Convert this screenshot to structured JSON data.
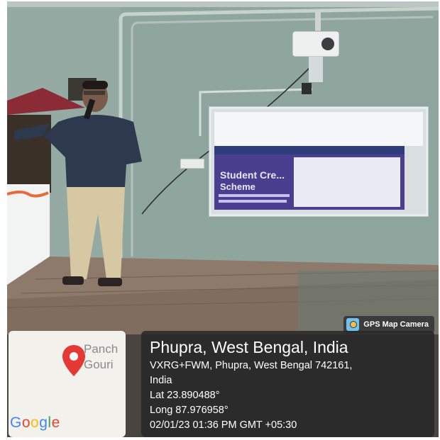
{
  "image": {
    "scene": "presentation-in-classroom",
    "description_elements": [
      "presenter-with-microphone",
      "projector",
      "projection-screen",
      "stage",
      "wall-conduit"
    ]
  },
  "projection": {
    "slide_heading": "Student Cre...",
    "slide_subheading": "Scheme"
  },
  "overlay": {
    "badge": {
      "icon": "gps-map-camera-icon",
      "label": "GPS Map Camera"
    },
    "map": {
      "place_line1": "Panch",
      "place_line2": "Gouri",
      "logo_letters": [
        {
          "ch": "G",
          "color": "#4285F4"
        },
        {
          "ch": "o",
          "color": "#EA4335"
        },
        {
          "ch": "o",
          "color": "#FBBC05"
        },
        {
          "ch": "g",
          "color": "#4285F4"
        },
        {
          "ch": "l",
          "color": "#34A853"
        },
        {
          "ch": "e",
          "color": "#EA4335"
        }
      ],
      "pin_color": "#e53935"
    },
    "info": {
      "title": "Phupra, West Bengal, India",
      "address_line1": "VXRG+FWM, Phupra, West Bengal 742161,",
      "address_line2": "India",
      "lat": "Lat 23.890488°",
      "long": "Long 87.976958°",
      "datetime": "02/01/23 01:36 PM GMT +05:30"
    }
  }
}
